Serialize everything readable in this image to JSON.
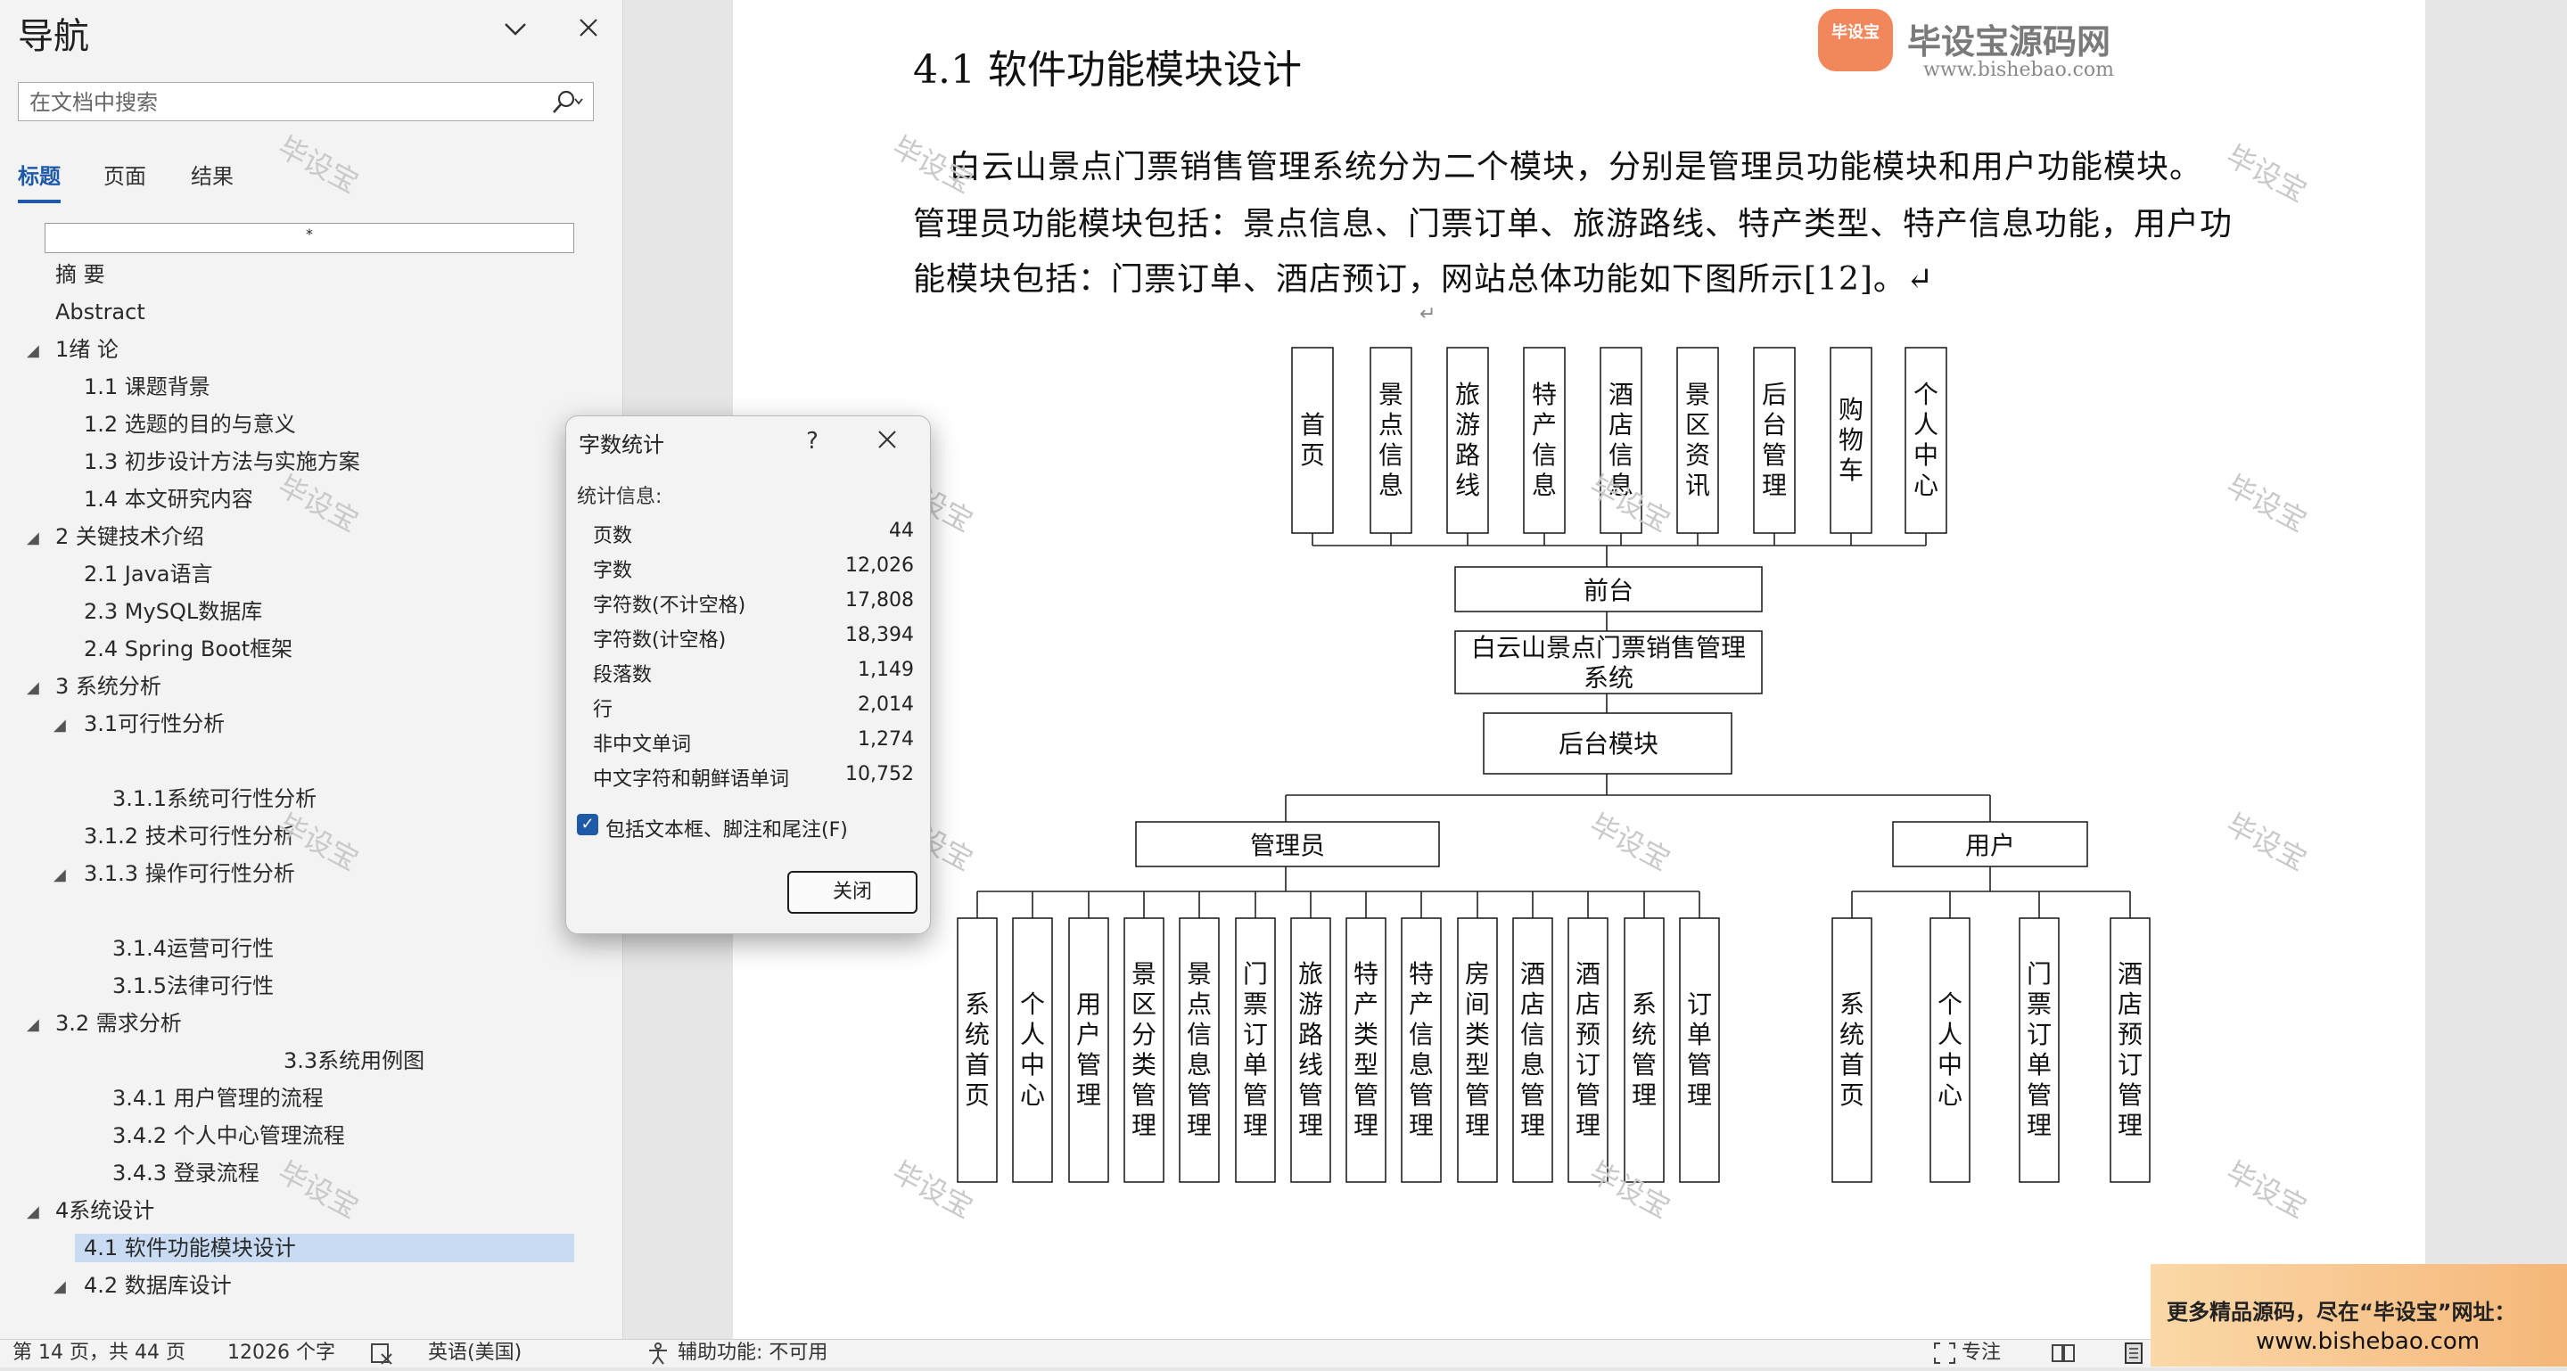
{
  "nav": {
    "title": "导航",
    "search_placeholder": "在文档中搜索",
    "tabs": [
      "标题",
      "页面",
      "结果"
    ],
    "blank_box_mark": "*",
    "headings": [
      {
        "text": "摘  要",
        "level": 1,
        "arrow": ""
      },
      {
        "text": "Abstract",
        "level": 1,
        "arrow": ""
      },
      {
        "text": "1绪 论",
        "level": 1,
        "arrow": "◢"
      },
      {
        "text": "1.1 课题背景",
        "level": 2,
        "arrow": ""
      },
      {
        "text": "1.2 选题的目的与意义",
        "level": 2,
        "arrow": ""
      },
      {
        "text": "1.3 初步设计方法与实施方案",
        "level": 2,
        "arrow": ""
      },
      {
        "text": "1.4 本文研究内容",
        "level": 2,
        "arrow": ""
      },
      {
        "text": "2 关键技术介绍",
        "level": 1,
        "arrow": "◢"
      },
      {
        "text": "2.1 Java语言",
        "level": 2,
        "arrow": ""
      },
      {
        "text": "2.3 MySQL数据库",
        "level": 2,
        "arrow": ""
      },
      {
        "text": "2.4 Spring Boot框架",
        "level": 2,
        "arrow": ""
      },
      {
        "text": "3 系统分析",
        "level": 1,
        "arrow": "◢"
      },
      {
        "text": "3.1可行性分析",
        "level": 2,
        "arrow": "◢"
      },
      {
        "text": "3.1.1系统可行性分析",
        "level": 3,
        "arrow": ""
      },
      {
        "text": "3.1.2 技术可行性分析",
        "level": 2,
        "arrow": ""
      },
      {
        "text": "3.1.3 操作可行性分析",
        "level": 2,
        "arrow": "◢"
      },
      {
        "text": "3.1.4运营可行性",
        "level": 3,
        "arrow": ""
      },
      {
        "text": "3.1.5法律可行性",
        "level": 3,
        "arrow": ""
      },
      {
        "text": "3.2 需求分析",
        "level": 1,
        "arrow": "◢"
      },
      {
        "text": "3.3系统用例图",
        "level": 4,
        "arrow": ""
      },
      {
        "text": "3.4.1 用户管理的流程",
        "level": 3,
        "arrow": ""
      },
      {
        "text": "3.4.2 个人中心管理流程",
        "level": 3,
        "arrow": ""
      },
      {
        "text": "3.4.3 登录流程",
        "level": 3,
        "arrow": ""
      },
      {
        "text": "4系统设计",
        "level": 1,
        "arrow": "◢"
      },
      {
        "text": "4.1 软件功能模块设计",
        "level": 2,
        "arrow": "",
        "selected": true
      },
      {
        "text": "4.2 数据库设计",
        "level": 2,
        "arrow": "◢"
      }
    ]
  },
  "document": {
    "section_title": "4.1  软件功能模块设计",
    "paragraph_lines": [
      "白云山景点门票销售管理系统分为二个模块，分别是管理员功能模块和用户功能模块。",
      "管理员功能模块包括：景点信息、门票订单、旅游路线、特产类型、特产信息功能，用户功",
      "能模块包括：门票订单、酒店预订，网站总体功能如下图所示[12]。↵"
    ],
    "return_mark": "↵",
    "watermark_text": "毕设宝",
    "logo": {
      "badge": "毕设宝",
      "name": "毕设宝源码网",
      "url": "www.bishebao.com"
    },
    "diagram": {
      "front_items": [
        "首页",
        "景点信息",
        "旅游路线",
        "特产信息",
        "酒店信息",
        "景区资讯",
        "后台管理",
        "购物车",
        "个人中心"
      ],
      "front_label": "前台",
      "system_label": "白云山景点门票销售管理系统",
      "backend_label": "后台模块",
      "admin_label": "管理员",
      "user_label": "用户",
      "admin_items": [
        "系统首页",
        "个人中心",
        "用户管理",
        "景区分类管理",
        "景点信息管理",
        "门票订单管理",
        "旅游路线管理",
        "特产类型管理",
        "特产信息管理",
        "房间类型管理",
        "酒店信息管理",
        "酒店预订管理",
        "系统管理",
        "订单管理"
      ],
      "user_items": [
        "系统首页",
        "个人中心",
        "门票订单管理",
        "酒店预订管理"
      ]
    }
  },
  "dialog": {
    "title": "字数统计",
    "help": "?",
    "stats_label": "统计信息:",
    "stats": [
      {
        "k": "页数",
        "v": "44"
      },
      {
        "k": "字数",
        "v": "12,026"
      },
      {
        "k": "字符数(不计空格)",
        "v": "17,808"
      },
      {
        "k": "字符数(计空格)",
        "v": "18,394"
      },
      {
        "k": "段落数",
        "v": "1,149"
      },
      {
        "k": "行",
        "v": "2,014"
      },
      {
        "k": "非中文单词",
        "v": "1,274"
      },
      {
        "k": "中文字符和朝鲜语单词",
        "v": "10,752"
      }
    ],
    "checkbox_label": "包括文本框、脚注和尾注(F)",
    "checkbox_checked": true,
    "close_button": "关闭"
  },
  "status": {
    "page": "第 14 页，共 44 页",
    "words": "12026 个字",
    "language": "英语(美国)",
    "accessibility": "辅助功能: 不可用",
    "focus": "专注"
  },
  "banner": {
    "line1": "更多精品源码，尽在“毕设宝”网址：",
    "line2": "www.bishebao.com"
  },
  "colors": {
    "accent": "#1e5aa8",
    "selection": "#c8dbf3"
  }
}
